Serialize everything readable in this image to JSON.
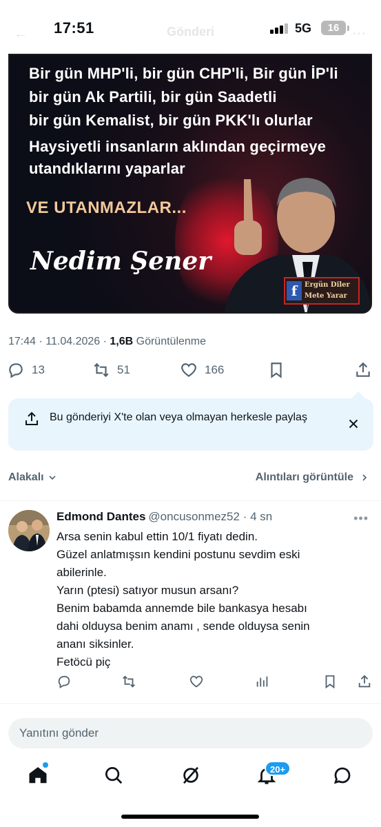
{
  "status_bar": {
    "time": "17:51",
    "network": "5G",
    "battery": "16",
    "ghost_title": "Gönderi"
  },
  "tweet_image": {
    "lines": [
      "Bir gün MHP'li, bir gün CHP'li, Bir gün İP'li",
      "bir gün Ak Partili, bir gün Saadetli",
      "bir gün Kemalist, bir gün PKK'lı olurlar",
      "Haysiyetli insanların aklından geçirmeye",
      "utandıklarını yaparlar"
    ],
    "slogan": "VE UTANMAZLAR...",
    "signature": "Nedim Şener",
    "watermark": "Ergün Diler\nMete Yarar"
  },
  "tweet_meta": {
    "time": "17:44",
    "separator": " · ",
    "date": "11.04.2026",
    "views_count": "1,6B",
    "views_label": "Görüntülenme"
  },
  "actions": {
    "replies": "13",
    "reposts": "51",
    "likes": "166"
  },
  "share_banner": {
    "text": "Bu gönderiyi X'te olan veya olmayan herkesle paylaş"
  },
  "sort": {
    "left_label": "Alakalı",
    "right_label": "Alıntıları görüntüle"
  },
  "reply": {
    "name": "Edmond Dantes",
    "handle": "@oncusonmez52",
    "separator": " · ",
    "time": "4 sn",
    "lines": [
      "Arsa senin kabul ettin 10/1 fiyatı dedin.",
      "Güzel anlatmışsın kendini postunu sevdim eski",
      "abilerinle.",
      "Yarın (ptesi) satıyor musun arsanı?",
      "Benim babamda annemde bile bankasya hesabı",
      "dahi olduysa benim anamı , sende olduysa senin",
      "ananı siksinler.",
      "Fetöcü piç"
    ]
  },
  "composer": {
    "placeholder": "Yanıtını gönder"
  },
  "tab_bar": {
    "notification_badge": "20+"
  },
  "colors": {
    "accent": "#1d9bf0",
    "muted": "#536471",
    "banner_bg": "#e8f5fd"
  }
}
